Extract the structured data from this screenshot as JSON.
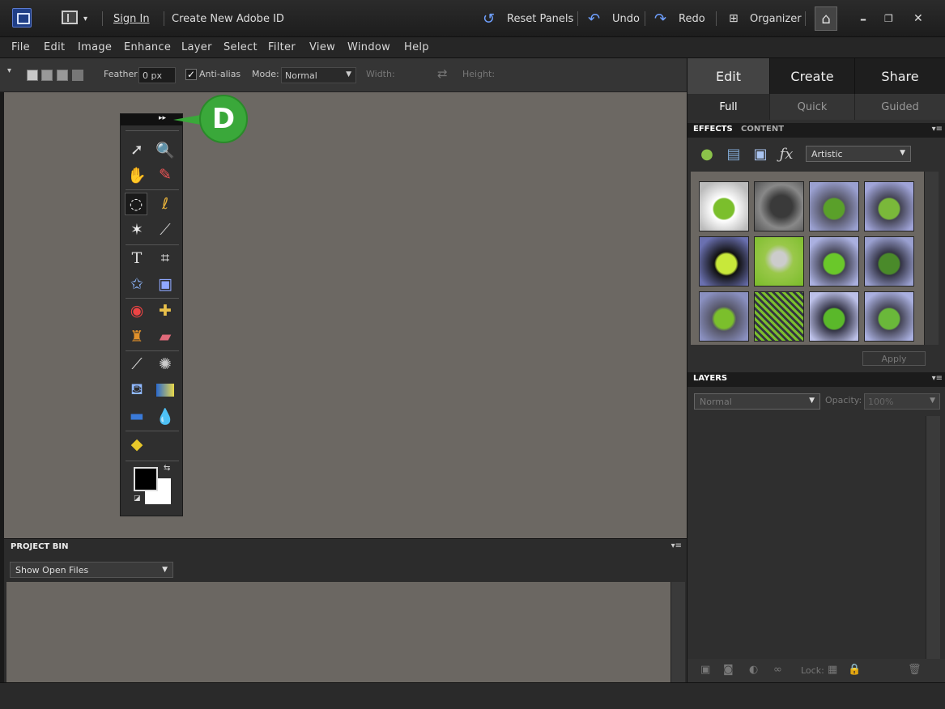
{
  "topbar": {
    "sign_in": "Sign In",
    "create_id": "Create New Adobe ID",
    "reset_panels": "Reset Panels",
    "undo": "Undo",
    "redo": "Redo",
    "organizer": "Organizer"
  },
  "menubar": {
    "items": [
      "File",
      "Edit",
      "Image",
      "Enhance",
      "Layer",
      "Select",
      "Filter",
      "View",
      "Window",
      "Help"
    ]
  },
  "options": {
    "feather_label": "Feather:",
    "feather_value": "0 px",
    "anti_alias_label": "Anti-alias",
    "anti_alias_checked": true,
    "mode_label": "Mode:",
    "mode_value": "Normal",
    "width_label": "Width:",
    "height_label": "Height:"
  },
  "tools_panel": {
    "collapse_glyph": "▸▸",
    "callout_label": "D",
    "active_tool": "elliptical-marquee"
  },
  "project_bin": {
    "title": "PROJECT BIN",
    "show_select": "Show Open Files"
  },
  "right_panel": {
    "main_tabs": [
      "Edit",
      "Create",
      "Share"
    ],
    "active_main_tab": "Edit",
    "sub_tabs": [
      "Full",
      "Quick",
      "Guided"
    ],
    "active_sub_tab": "Full",
    "effects_tab": "EFFECTS",
    "content_tab": "CONTENT",
    "filter_category": "Artistic",
    "apply_label": "Apply",
    "layers_title": "LAYERS",
    "blend_mode": "Normal",
    "opacity_label": "Opacity:",
    "opacity_value": "100%",
    "lock_label": "Lock:"
  },
  "colors": {
    "canvas": "#6c6863",
    "callout": "#3aa83a",
    "apple_green": "#7bbf2c"
  }
}
